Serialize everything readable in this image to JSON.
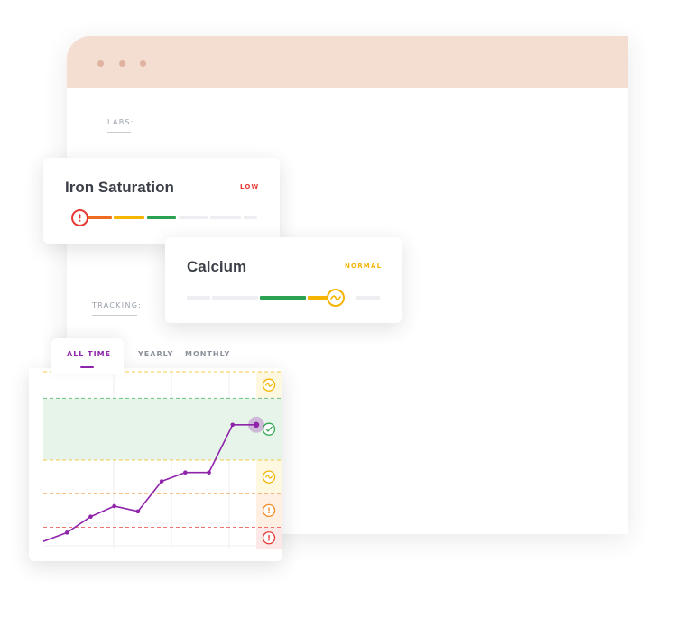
{
  "sections": {
    "labs_label": "LABS:",
    "tracking_label": "TRACKING:"
  },
  "labs": [
    {
      "name": "Iron Saturation",
      "status": "LOW",
      "status_color": "#e53935",
      "marker_icon": "alert-icon"
    },
    {
      "name": "Calcium",
      "status": "NORMAL",
      "status_color": "#f5b400",
      "marker_icon": "approx-icon"
    }
  ],
  "tracking": {
    "tabs": [
      {
        "label": "ALL TIME",
        "active": true
      },
      {
        "label": "YEARLY",
        "active": false
      },
      {
        "label": "MONTHLY",
        "active": false
      }
    ],
    "zone_icons": [
      "approx-icon",
      "check-icon",
      "approx-icon",
      "alert-icon",
      "alert-icon"
    ],
    "colors": {
      "line": "#8e24aa",
      "normal_zone": "#e6f4ea",
      "normal_border": "#34a853",
      "borderline": "#f5b400",
      "warning": "#f08a24",
      "critical": "#e53935"
    }
  },
  "chart_data": {
    "type": "line",
    "x": [
      0,
      1,
      2,
      3,
      4,
      5,
      6,
      7,
      8,
      9
    ],
    "series": [
      {
        "values": [
          0.4,
          0.9,
          1.8,
          2.4,
          2.1,
          3.8,
          4.3,
          4.3,
          7.0,
          7.0
        ]
      }
    ],
    "ylim": [
      0,
      10
    ],
    "bands": [
      {
        "zone": "high-borderline",
        "range": [
          8.5,
          10
        ]
      },
      {
        "zone": "normal",
        "range": [
          5.0,
          8.5
        ]
      },
      {
        "zone": "low-borderline",
        "range": [
          3.1,
          5.0
        ]
      },
      {
        "zone": "low",
        "range": [
          1.2,
          3.1
        ]
      },
      {
        "zone": "critical-low",
        "range": [
          0,
          1.2
        ]
      }
    ],
    "xlabel": "",
    "ylabel": "",
    "title": ""
  }
}
